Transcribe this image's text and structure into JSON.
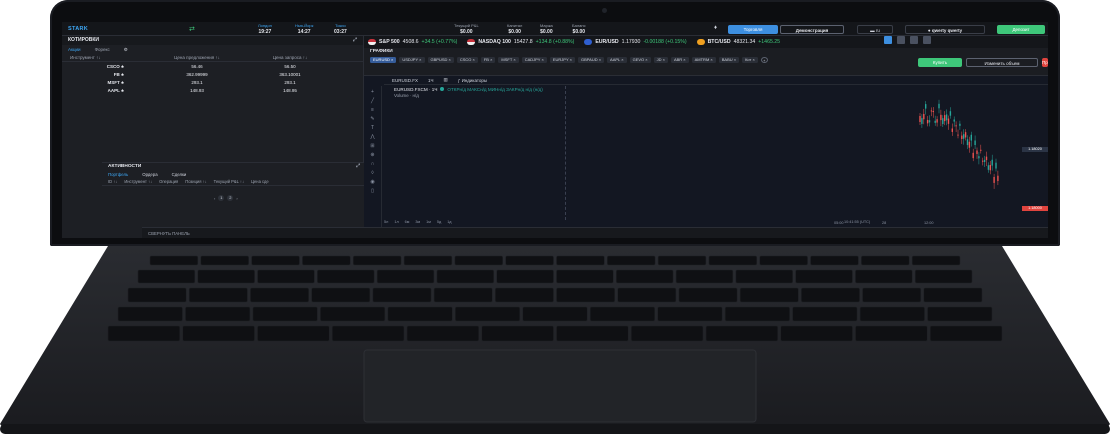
{
  "app": {
    "logo": "STARK"
  },
  "clocks": [
    {
      "label": "Лондон",
      "time": "19:27"
    },
    {
      "label": "Нью-Йорк",
      "time": "14:27"
    },
    {
      "label": "Токио",
      "time": "03:27"
    }
  ],
  "stats": [
    {
      "label": "Текущий P&L",
      "value": "$0.00"
    },
    {
      "label": "Капитал",
      "value": "$0.00"
    },
    {
      "label": "Маржа",
      "value": "$0.00"
    },
    {
      "label": "Баланс",
      "value": "$0.00"
    }
  ],
  "topbar": {
    "mode_real": "Торговля",
    "mode_demo": "Демонстрация",
    "lang": "ru",
    "user": "qwerty qwerty",
    "deposit": "Депозит"
  },
  "quotes": {
    "title": "КОТИРОВКИ",
    "tabs": [
      "Акции",
      "Форекс"
    ],
    "headers": [
      "Инструмент ↑↓",
      "Цена предложения ↑↓",
      "Цена запроса ↑↓"
    ],
    "rows": [
      {
        "symbol": "CSCO",
        "bid": "56.46",
        "ask": "56.50"
      },
      {
        "symbol": "FB",
        "bid": "362.99999",
        "ask": "363.10001"
      },
      {
        "symbol": "MSFT",
        "bid": "293.1",
        "ask": "293.1"
      },
      {
        "symbol": "AAPL",
        "bid": "148.93",
        "ask": "148.95"
      }
    ]
  },
  "activity": {
    "title": "АКТИВНОСТИ",
    "tabs": [
      "Портфель",
      "Ордера",
      "Сделки"
    ],
    "headers": [
      "ID ↑↓",
      "Инструмент ↑↓",
      "Операция",
      "Позиция ↑↓",
      "Текущий P&L ↑↓",
      "Цена сде"
    ],
    "pages": [
      "1",
      "2"
    ]
  },
  "bottom_panel": {
    "label": "СВЕРНУТЬ ПАНЕЛЬ"
  },
  "ticker": [
    {
      "symbol": "S&P 500",
      "price": "4508.6",
      "change": "+34.5 (+0.77%)"
    },
    {
      "symbol": "NASDAQ 100",
      "price": "15427.8",
      "change": "+134.8 (+0.88%)"
    },
    {
      "symbol": "EUR/USD",
      "price": "1.17930",
      "change": "-0.00188 (+0.15%)"
    },
    {
      "symbol": "BTC/USD",
      "price": "48321.34",
      "change": "+1465.25"
    }
  ],
  "charts": {
    "title": "ГРАФИКИ",
    "instruments": [
      "EURUSD",
      "USDJPY",
      "GBPUSD",
      "CSCO",
      "FB",
      "MSFT",
      "CADJPY",
      "EURJPY",
      "GBPAUD",
      "AAPL",
      "GEVO",
      "JD",
      "ABR",
      "AMTRM",
      "BABU",
      "Кот"
    ],
    "buy": "Купить",
    "modify": "Изменить объем",
    "sell": "Продать",
    "toolbar": {
      "symbol": "EURUSD.FX",
      "interval": "1Ч",
      "indicators": "Индикаторы"
    },
    "legend": "EURUSD.FXCM · 1Ч",
    "ohlc": "ОТКРн/д МАКСн/д МИНн/д ЗАКРн/д н/д (н/д)",
    "volume": "Volume · н/д",
    "price_tag_1": "1.18020",
    "price_tag_2": "1.18000",
    "xaxis": [
      "05:00",
      "28",
      "12:00"
    ],
    "bottom_tabs": [
      "5л",
      "1л",
      "6м",
      "3м",
      "1м",
      "5д",
      "1д"
    ],
    "tz": "10:41:55 (UTC)"
  }
}
